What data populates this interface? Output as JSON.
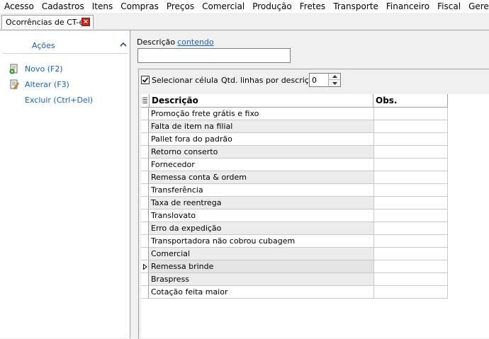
{
  "menu": [
    "Acesso",
    "Cadastros",
    "Itens",
    "Compras",
    "Preços",
    "Comercial",
    "Produção",
    "Fretes",
    "Transporte",
    "Financeiro",
    "Fiscal",
    "Gerencial"
  ],
  "tab": {
    "title": "Ocorrências de CT-e",
    "close_glyph": "×"
  },
  "actions": {
    "title": "Ações",
    "items": [
      {
        "label": "Novo (F2)",
        "icon": "new-document-icon"
      },
      {
        "label": "Alterar (F3)",
        "icon": "edit-document-icon"
      },
      {
        "label": "Excluir (Ctrl+Del)",
        "icon": ""
      }
    ]
  },
  "filter": {
    "label": "Descrição",
    "mode": "contendo",
    "value": ""
  },
  "options": {
    "select_cell_label": "Selecionar célula",
    "select_cell_checked": true,
    "lines_label": "Qtd. linhas por descrição",
    "lines_value": "0"
  },
  "grid": {
    "columns": [
      "Descrição",
      "Obs."
    ],
    "rows": [
      "Promoção frete grátis e fixo",
      "Falta de item na filial",
      "Pallet fora do padrão",
      "Retorno conserto",
      "Fornecedor",
      "Remessa conta & ordem",
      "Transferência",
      "Taxa de reentrega",
      "Translovato",
      "Erro da expedição",
      "Transportadora não cobrou cubagem",
      "Comercial",
      "Remessa brinde",
      "Braspress",
      "Cotação feita maior"
    ],
    "current_row": 12
  }
}
